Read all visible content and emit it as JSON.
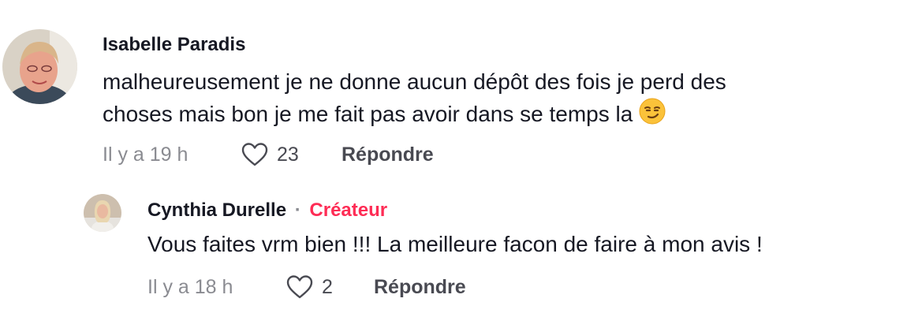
{
  "comments": [
    {
      "author": "Isabelle Paradis",
      "text_line1": "malheureusement je ne donne aucun dépôt des fois je perd des",
      "text_line2": "choses mais bon je me fait pas avoir dans se temps la",
      "emoji": "smirking-face-emoji",
      "time": "Il y a 19 h",
      "likes": "23",
      "reply_label": "Répondre"
    }
  ],
  "reply": {
    "author": "Cynthia Durelle",
    "separator": "·",
    "badge": "Créateur",
    "text": "Vous faites vrm bien !!! La meilleure facon de faire à mon avis !",
    "time": "Il y a 18 h",
    "likes": "2",
    "reply_label": "Répondre"
  },
  "colors": {
    "text": "#161823",
    "muted": "#8a8b91",
    "creator": "#fe2c55"
  }
}
